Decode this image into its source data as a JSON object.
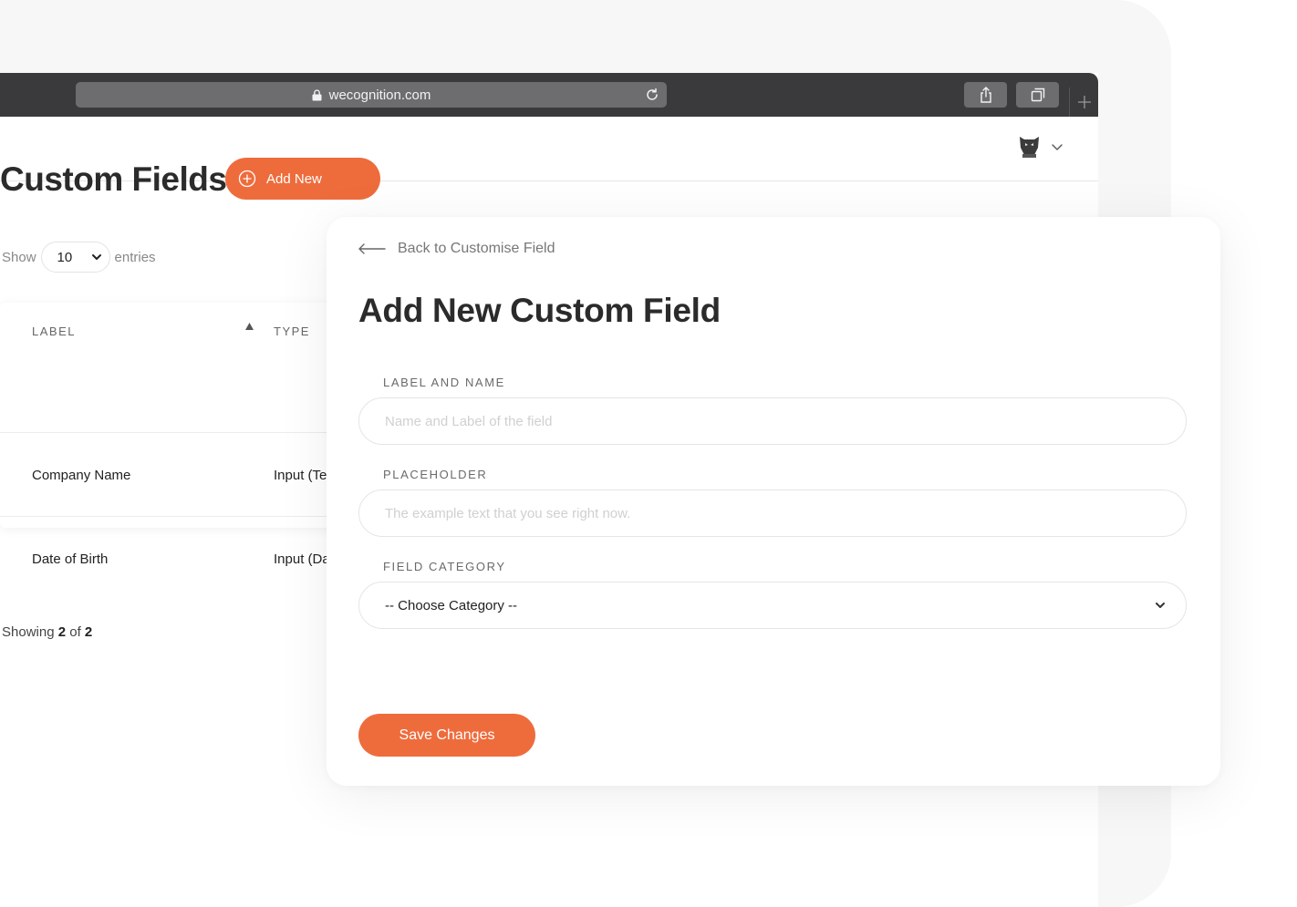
{
  "browser": {
    "url": "wecognition.com"
  },
  "page": {
    "title": "Custom Fields",
    "add_new_label": "Add New",
    "show_label": "Show",
    "entries_value": "10",
    "entries_label": "entries",
    "table": {
      "columns": [
        "LABEL",
        "TYPE"
      ],
      "rows": [
        {
          "label": "Company Name",
          "type": "Input (Te"
        },
        {
          "label": "Date of Birth",
          "type": "Input (Da"
        }
      ]
    },
    "showing_prefix": "Showing",
    "showing_count": "2",
    "showing_of": "of",
    "showing_total": "2"
  },
  "modal": {
    "back_label": "Back to Customise Field",
    "title": "Add New Custom Field",
    "fields": {
      "label_name": {
        "label": "LABEL AND NAME",
        "placeholder": "Name and Label of the field"
      },
      "placeholder": {
        "label": "PLACEHOLDER",
        "placeholder": "The example text that you see right now."
      },
      "category": {
        "label": "FIELD CATEGORY",
        "value": "-- Choose Category --"
      }
    },
    "save_label": "Save Changes"
  },
  "colors": {
    "accent": "#ee6c3c",
    "browser_chrome": "#3a3a3c",
    "url_bar": "#6d6d70"
  }
}
